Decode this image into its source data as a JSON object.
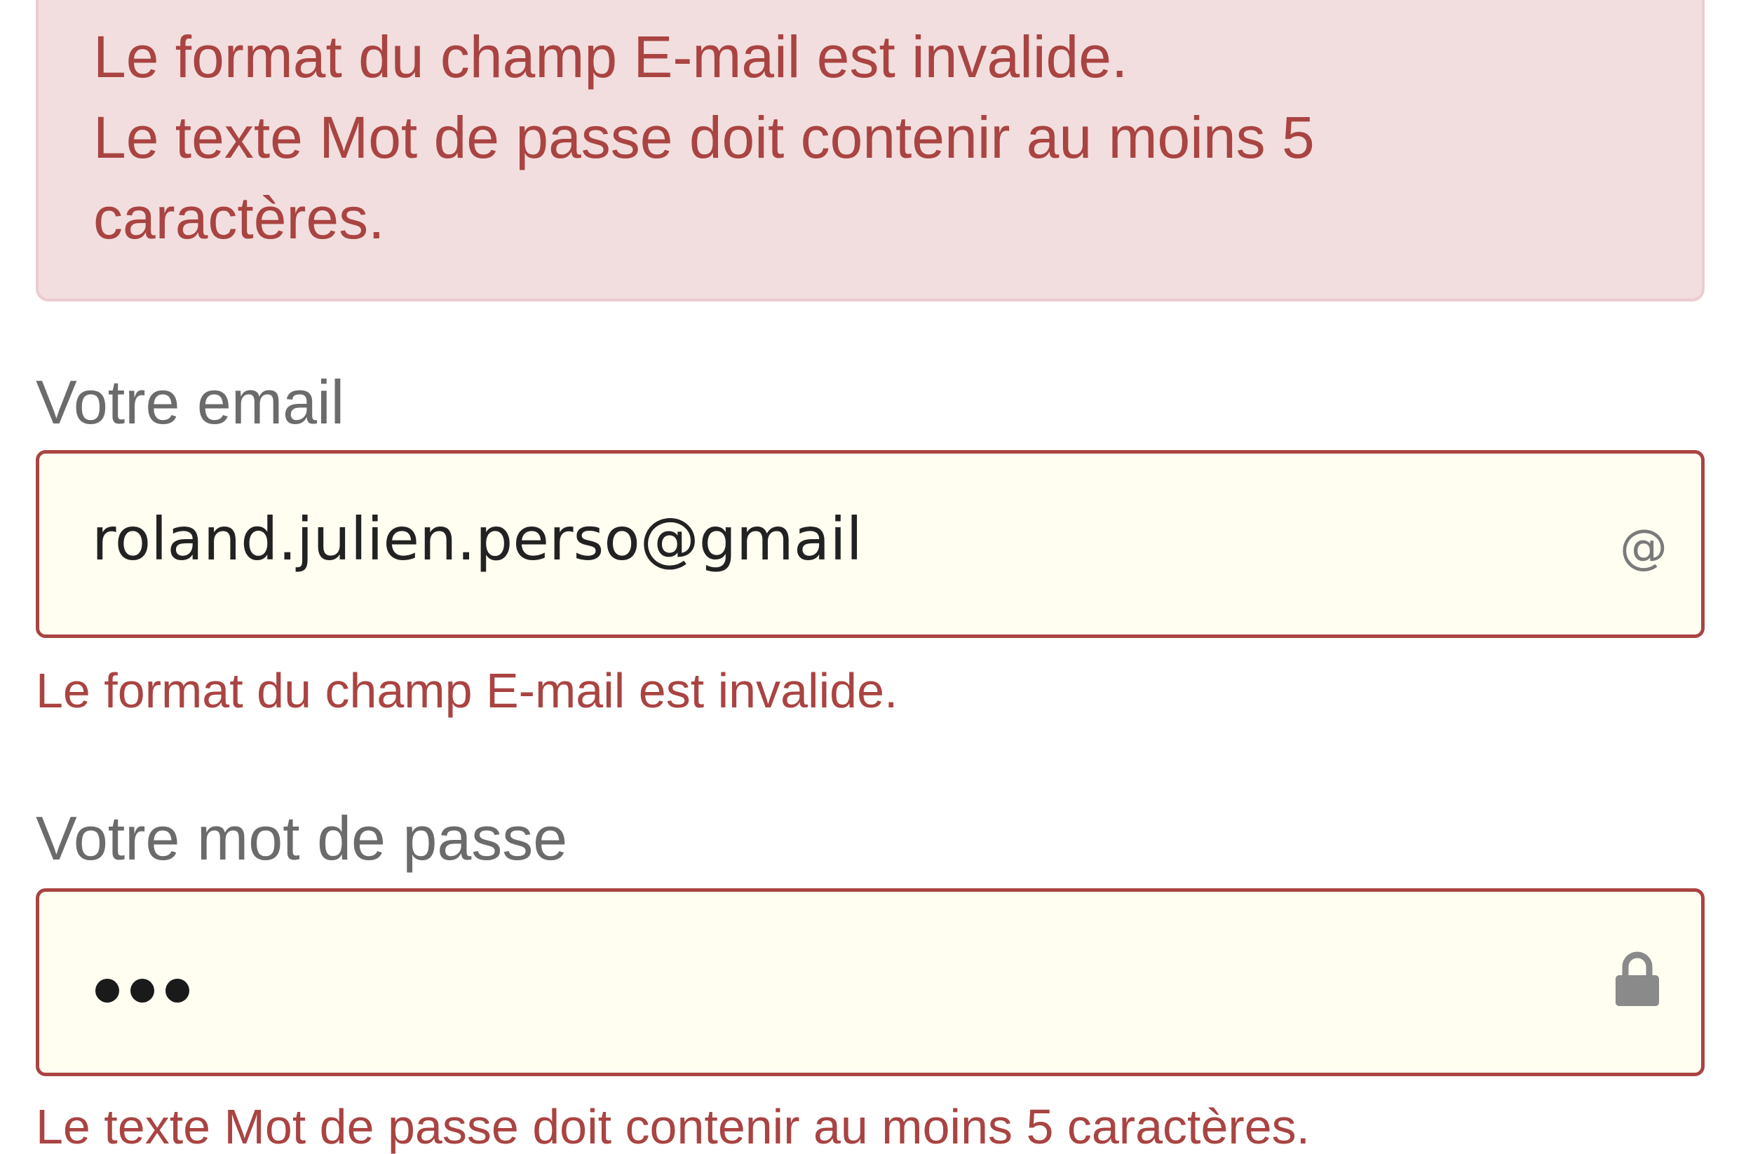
{
  "alert": {
    "line1": "Le format du champ E-mail est invalide.",
    "line2": "Le texte Mot de passe doit contenir au moins 5",
    "line3": "caractères."
  },
  "email": {
    "label": "Votre email",
    "value": "roland.julien.perso@gmail",
    "icon": "@",
    "error": "Le format du champ E-mail est invalide."
  },
  "password": {
    "label": "Votre mot de passe",
    "masked_length": 3,
    "icon": "lock-icon",
    "error": "Le texte Mot de passe doit contenir au moins 5 caractères."
  },
  "colors": {
    "error_text": "#a94442",
    "alert_background": "#f2dede",
    "input_background": "#fffef1"
  }
}
